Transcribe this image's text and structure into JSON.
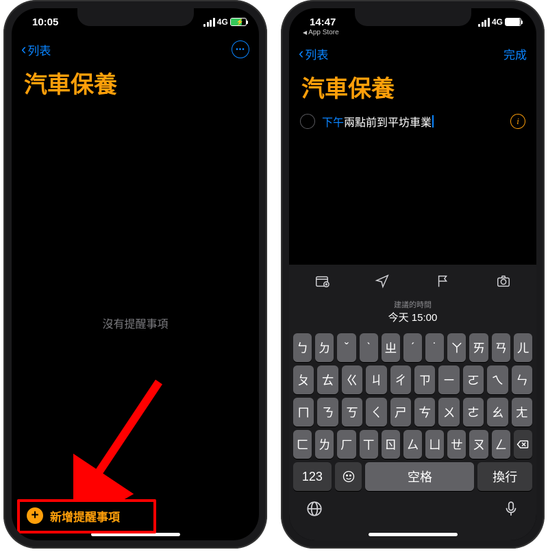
{
  "left": {
    "status": {
      "time": "10:05",
      "network": "4G"
    },
    "nav": {
      "back_label": "列表"
    },
    "title": "汽車保養",
    "empty_text": "沒有提醒事項",
    "add_button_label": "新增提醒事項"
  },
  "right": {
    "status": {
      "time": "14:47",
      "network": "4G"
    },
    "return_to": "App Store",
    "nav": {
      "back_label": "列表",
      "done_label": "完成"
    },
    "title": "汽車保養",
    "reminder": {
      "highlight_text": "下午",
      "rest_text": "兩點前到平坊車業"
    },
    "suggestion": {
      "label": "建議的時間",
      "value": "今天 15:00"
    },
    "keyboard": {
      "row1": [
        "ㄅ",
        "ㄉ",
        "ˇ",
        "ˋ",
        "ㄓ",
        "ˊ",
        "˙",
        "ㄚ",
        "ㄞ",
        "ㄢ",
        "ㄦ"
      ],
      "row2": [
        "ㄆ",
        "ㄊ",
        "ㄍ",
        "ㄐ",
        "ㄔ",
        "ㄗ",
        "ㄧ",
        "ㄛ",
        "ㄟ",
        "ㄣ"
      ],
      "row3": [
        "ㄇ",
        "ㄋ",
        "ㄎ",
        "ㄑ",
        "ㄕ",
        "ㄘ",
        "ㄨ",
        "ㄜ",
        "ㄠ",
        "ㄤ"
      ],
      "row4": [
        "ㄈ",
        "ㄌ",
        "ㄏ",
        "ㄒ",
        "ㄖ",
        "ㄙ",
        "ㄩ",
        "ㄝ",
        "ㄡ",
        "ㄥ"
      ],
      "numbers_key": "123",
      "space_label": "空格",
      "return_label": "換行"
    }
  },
  "colors": {
    "accent_orange": "#ff9f0a",
    "accent_blue": "#0a84ff",
    "annotation_red": "#ff0000"
  }
}
